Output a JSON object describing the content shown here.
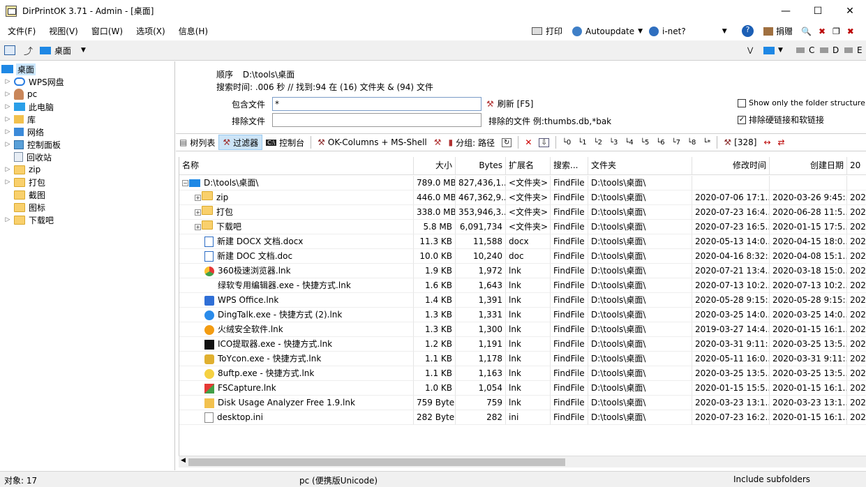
{
  "window": {
    "title": "DirPrintOK 3.71 - Admin - [桌面]"
  },
  "menu": [
    "文件(F)",
    "视图(V)",
    "窗口(W)",
    "选项(X)",
    "信息(H)"
  ],
  "menu_right": {
    "print": "打印",
    "autoupdate": "Autoupdate",
    "inet": "i-net?",
    "donate": "捐赠"
  },
  "toolbar2": {
    "location": "桌面",
    "drives": [
      "C",
      "D",
      "E"
    ]
  },
  "tree": {
    "root": "桌面",
    "items": [
      "WPS网盘",
      "pc",
      "此电脑",
      "库",
      "网络",
      "控制面板",
      "回收站",
      "zip",
      "打包",
      "截图",
      "图标",
      "下载吧"
    ]
  },
  "info": {
    "order_label": "顺序",
    "order_path": "D:\\tools\\桌面",
    "search_line": "搜索时间: .006 秒 //  找到:94 在 (16) 文件夹 & (94) 文件"
  },
  "filter": {
    "include_label": "包含文件",
    "include_value": "*",
    "refresh": "刷新 [F5]",
    "exclude_label": "排除文件",
    "exclude_value": "",
    "exclude_example": "排除的文件 例:thumbs.db,*bak",
    "opt1": "Show only the folder structure",
    "opt2": "排除硬链接和软链接"
  },
  "tabs": {
    "tree": "树列表",
    "filter": "过滤器",
    "console": "控制台",
    "columns": "OK-Columns + MS-Shell",
    "group": "分组: 路径",
    "count": "[328]"
  },
  "columns": [
    "名称",
    "大小",
    "Bytes",
    "扩展名",
    "搜索...",
    "文件夹",
    "修改时间",
    "创建日期",
    "20"
  ],
  "rows": [
    {
      "name": "D:\\tools\\桌面\\",
      "size": "789.0 MB",
      "bytes": "827,436,1...",
      "ext": "<文件夹>",
      "search": "FindFile",
      "folder": "D:\\tools\\桌面\\",
      "mod": "",
      "cre": "",
      "x": ""
    },
    {
      "name": "zip",
      "size": "446.0 MB",
      "bytes": "467,362,9...",
      "ext": "<文件夹>",
      "search": "FindFile",
      "folder": "D:\\tools\\桌面\\",
      "mod": "2020-07-06 17:1...",
      "cre": "2020-03-26 9:45:...",
      "x": "202"
    },
    {
      "name": "打包",
      "size": "338.0 MB",
      "bytes": "353,946,3...",
      "ext": "<文件夹>",
      "search": "FindFile",
      "folder": "D:\\tools\\桌面\\",
      "mod": "2020-07-23 16:4...",
      "cre": "2020-06-28 11:5...",
      "x": "202"
    },
    {
      "name": "下载吧",
      "size": "5.8 MB",
      "bytes": "6,091,734",
      "ext": "<文件夹>",
      "search": "FindFile",
      "folder": "D:\\tools\\桌面\\",
      "mod": "2020-07-23 16:5...",
      "cre": "2020-01-15 17:5...",
      "x": "202"
    },
    {
      "name": "新建 DOCX 文档.docx",
      "size": "11.3 KB",
      "bytes": "11,588",
      "ext": "docx",
      "search": "FindFile",
      "folder": "D:\\tools\\桌面\\",
      "mod": "2020-05-13 14:0...",
      "cre": "2020-04-15 18:0...",
      "x": "202"
    },
    {
      "name": "新建 DOC 文档.doc",
      "size": "10.0 KB",
      "bytes": "10,240",
      "ext": "doc",
      "search": "FindFile",
      "folder": "D:\\tools\\桌面\\",
      "mod": "2020-04-16 8:32:...",
      "cre": "2020-04-08 15:1...",
      "x": "202"
    },
    {
      "name": "360极速浏览器.lnk",
      "size": "1.9 KB",
      "bytes": "1,972",
      "ext": "lnk",
      "search": "FindFile",
      "folder": "D:\\tools\\桌面\\",
      "mod": "2020-07-21 13:4...",
      "cre": "2020-03-18 15:0...",
      "x": "202"
    },
    {
      "name": "绿软专用编辑器.exe - 快捷方式.lnk",
      "size": "1.6 KB",
      "bytes": "1,643",
      "ext": "lnk",
      "search": "FindFile",
      "folder": "D:\\tools\\桌面\\",
      "mod": "2020-07-13 10:2...",
      "cre": "2020-07-13 10:2...",
      "x": "202"
    },
    {
      "name": "WPS Office.lnk",
      "size": "1.4 KB",
      "bytes": "1,391",
      "ext": "lnk",
      "search": "FindFile",
      "folder": "D:\\tools\\桌面\\",
      "mod": "2020-05-28 9:15:...",
      "cre": "2020-05-28 9:15:...",
      "x": "202"
    },
    {
      "name": "DingTalk.exe - 快捷方式 (2).lnk",
      "size": "1.3 KB",
      "bytes": "1,331",
      "ext": "lnk",
      "search": "FindFile",
      "folder": "D:\\tools\\桌面\\",
      "mod": "2020-03-25 14:0...",
      "cre": "2020-03-25 14:0...",
      "x": "202"
    },
    {
      "name": "火绒安全软件.lnk",
      "size": "1.3 KB",
      "bytes": "1,300",
      "ext": "lnk",
      "search": "FindFile",
      "folder": "D:\\tools\\桌面\\",
      "mod": "2019-03-27 14:4...",
      "cre": "2020-01-15 16:1...",
      "x": "202"
    },
    {
      "name": "ICO提取器.exe - 快捷方式.lnk",
      "size": "1.2 KB",
      "bytes": "1,191",
      "ext": "lnk",
      "search": "FindFile",
      "folder": "D:\\tools\\桌面\\",
      "mod": "2020-03-31 9:11:...",
      "cre": "2020-03-25 13:5...",
      "x": "202"
    },
    {
      "name": "ToYcon.exe - 快捷方式.lnk",
      "size": "1.1 KB",
      "bytes": "1,178",
      "ext": "lnk",
      "search": "FindFile",
      "folder": "D:\\tools\\桌面\\",
      "mod": "2020-05-11 16:0...",
      "cre": "2020-03-31 9:11:...",
      "x": "202"
    },
    {
      "name": "8uftp.exe - 快捷方式.lnk",
      "size": "1.1 KB",
      "bytes": "1,163",
      "ext": "lnk",
      "search": "FindFile",
      "folder": "D:\\tools\\桌面\\",
      "mod": "2020-03-25 13:5...",
      "cre": "2020-03-25 13:5...",
      "x": "202"
    },
    {
      "name": "FSCapture.lnk",
      "size": "1.0 KB",
      "bytes": "1,054",
      "ext": "lnk",
      "search": "FindFile",
      "folder": "D:\\tools\\桌面\\",
      "mod": "2020-01-15 15:5...",
      "cre": "2020-01-15 16:1...",
      "x": "202"
    },
    {
      "name": "Disk Usage Analyzer Free 1.9.lnk",
      "size": "759 Byte",
      "bytes": "759",
      "ext": "lnk",
      "search": "FindFile",
      "folder": "D:\\tools\\桌面\\",
      "mod": "2020-03-23 13:1...",
      "cre": "2020-03-23 13:1...",
      "x": "202"
    },
    {
      "name": "desktop.ini",
      "size": "282 Byte",
      "bytes": "282",
      "ext": "ini",
      "search": "FindFile",
      "folder": "D:\\tools\\桌面\\",
      "mod": "2020-07-23 16:2...",
      "cre": "2020-01-15 16:1...",
      "x": "202"
    }
  ],
  "status": {
    "objects": "对象: 17",
    "pc": "pc (便携版Unicode)",
    "subfolders": "Include subfolders"
  }
}
